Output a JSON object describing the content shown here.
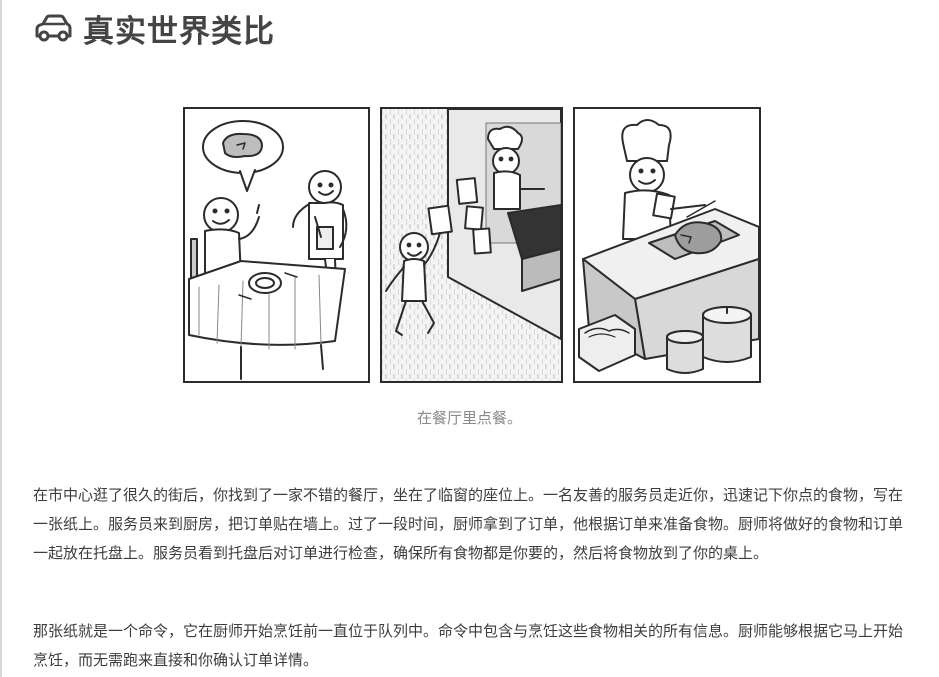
{
  "section": {
    "icon": "car-icon",
    "title": "真实世界类比"
  },
  "figure": {
    "panels": [
      "restaurant-customer-panel",
      "kitchen-window-panel",
      "chef-cooking-panel"
    ],
    "caption": "在餐厅里点餐。"
  },
  "paragraphs": [
    "在市中心逛了很久的街后，你找到了一家不错的餐厅，坐在了临窗的座位上。一名友善的服务员走近你，迅速记下你点的食物，写在一张纸上。服务员来到厨房，把订单贴在墙上。过了一段时间，厨师拿到了订单，他根据订单来准备食物。厨师将做好的食物和订单一起放在托盘上。服务员看到托盘后对订单进行检查，确保所有食物都是你要的，然后将食物放到了你的桌上。",
    "那张纸就是一个命令，它在厨师开始烹饪前一直位于队列中。命令中包含与烹饪这些食物相关的所有信息。厨师能够根据它马上开始烹饪，而无需跑来直接和你确认订单详情。"
  ]
}
